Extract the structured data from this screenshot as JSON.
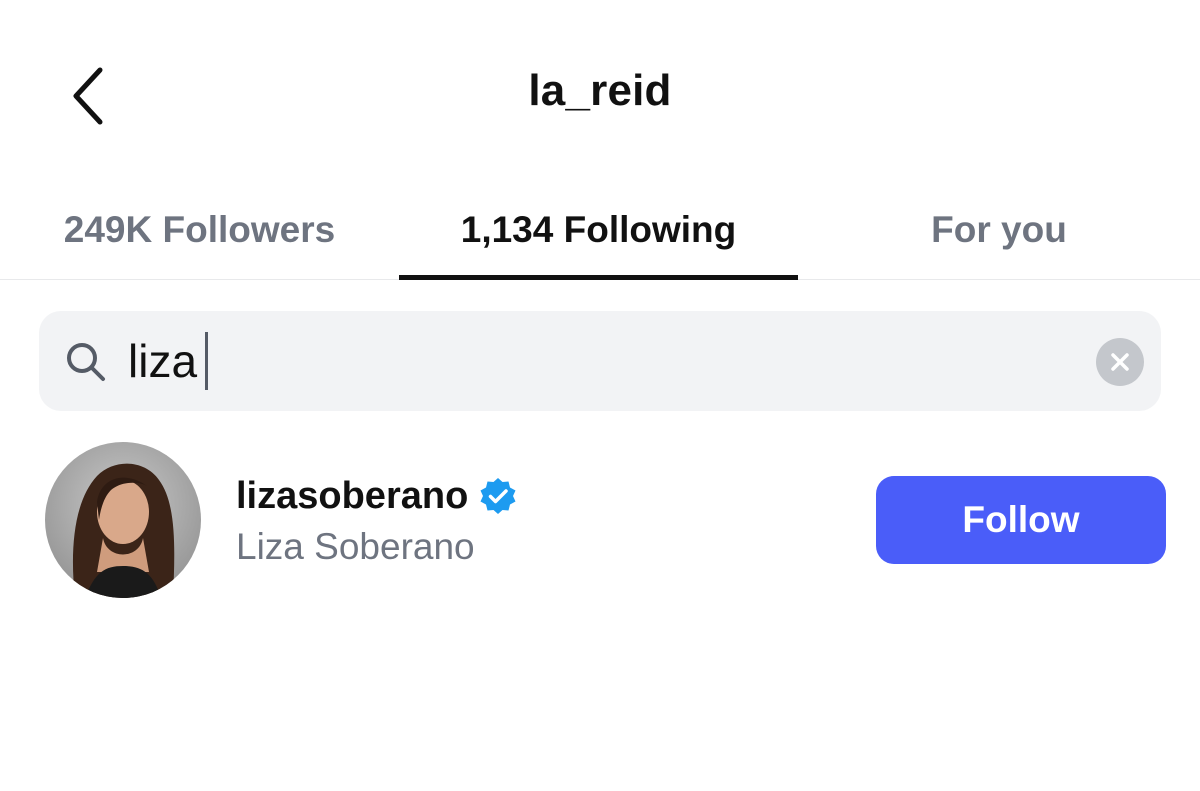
{
  "header": {
    "title": "la_reid",
    "back_icon": "chevron-left-icon"
  },
  "tabs": [
    {
      "label": "249K Followers",
      "active": false
    },
    {
      "label": "1,134 Following",
      "active": true
    },
    {
      "label": "For you",
      "active": false
    }
  ],
  "search": {
    "icon": "search-icon",
    "value": "liza",
    "clear_icon": "clear-icon"
  },
  "results": [
    {
      "username": "lizasoberano",
      "verified": true,
      "full_name": "Liza Soberano",
      "button_label": "Follow"
    }
  ],
  "colors": {
    "follow_button": "#4a5df9",
    "verified_badge": "#1d9bf0",
    "inactive_text": "#6e7480",
    "search_bg": "#f2f3f5"
  }
}
